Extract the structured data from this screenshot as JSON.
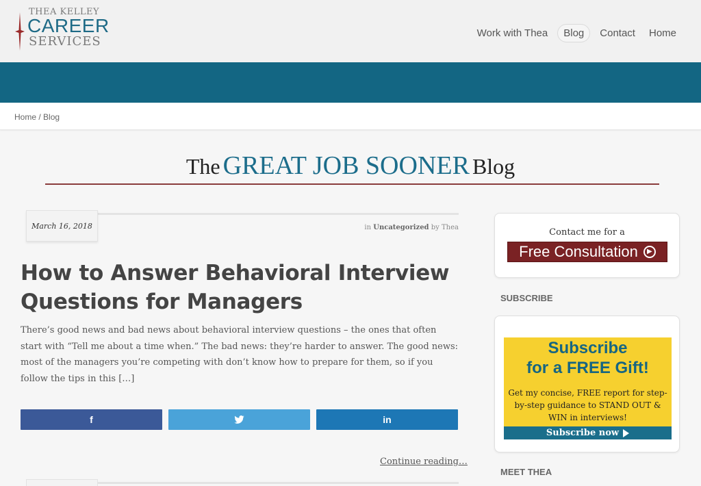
{
  "header": {
    "logo": {
      "line1": "THEA KELLEY",
      "line2": "CAREER",
      "line3": "SERVICES"
    },
    "nav": [
      {
        "label": "Work with Thea",
        "active": false
      },
      {
        "label": "Blog",
        "active": true
      },
      {
        "label": "Contact",
        "active": false
      },
      {
        "label": "Home",
        "active": false
      }
    ],
    "band_color": "#136683"
  },
  "breadcrumb": {
    "home": "Home",
    "separator": "/",
    "current": "Blog"
  },
  "blog_title": {
    "the": "The",
    "great": "GREAT JOB SOONER",
    "blog": "Blog"
  },
  "post": {
    "date": "March 16, 2018",
    "meta_in": "in",
    "category": "Uncategorized",
    "meta_by": "by",
    "author": "Thea",
    "title": "How to Answer Behavioral Interview Questions for Managers",
    "excerpt": "There’s good news and bad news about behavioral interview questions – the ones that often start with “Tell me about a time when.” The bad news: they’re harder to answer. The good news: most of the managers you’re competing with don’t know how to prepare for them, so if you follow the tips in this […]",
    "share": [
      {
        "network": "facebook",
        "icon": "f",
        "color": "#3b5998"
      },
      {
        "network": "twitter",
        "icon": "twitter-bird",
        "color": "#4aa3d9"
      },
      {
        "network": "linkedin",
        "icon": "in",
        "color": "#1d77b5"
      }
    ],
    "continue": "Continue reading…"
  },
  "sidebar": {
    "consult": {
      "text": "Contact me for a",
      "button": "Free Consultation",
      "button_color": "#7a2224"
    },
    "subscribe_heading": "SUBSCRIBE",
    "subscribe": {
      "line1": "Subscribe",
      "line2": "for a FREE Gift!",
      "body": "Get my concise, FREE report for step-by-step guidance to STAND OUT & WIN in interviews!",
      "button": "Subscribe now",
      "box_color": "#f6d02f"
    },
    "meet_heading": "MEET THEA"
  }
}
